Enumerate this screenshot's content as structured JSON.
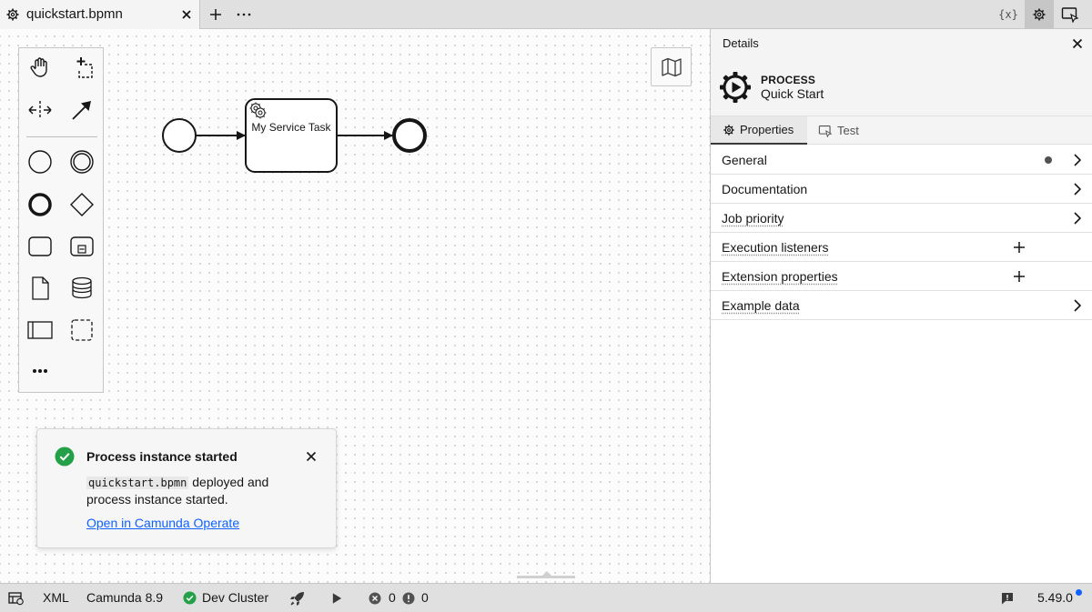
{
  "tab": {
    "title": "quickstart.bpmn"
  },
  "topbar": {
    "variables_label": "{x}"
  },
  "diagram": {
    "task_label": "My Service Task"
  },
  "notification": {
    "title": "Process instance started",
    "body_code": "quickstart.bpmn",
    "body_text": " deployed and process instance started.",
    "link": "Open in Camunda Operate"
  },
  "panel": {
    "title": "Details",
    "element_type": "PROCESS",
    "element_name": "Quick Start",
    "tabs": [
      "Properties",
      "Test"
    ],
    "groups": [
      {
        "label": "General",
        "action": "chevron",
        "has_dot": true,
        "dotted": false
      },
      {
        "label": "Documentation",
        "action": "chevron",
        "has_dot": false,
        "dotted": false
      },
      {
        "label": "Job priority",
        "action": "chevron",
        "has_dot": false,
        "dotted": true
      },
      {
        "label": "Execution listeners",
        "action": "plus",
        "has_dot": false,
        "dotted": true
      },
      {
        "label": "Extension properties",
        "action": "plus",
        "has_dot": false,
        "dotted": true
      },
      {
        "label": "Example data",
        "action": "chevron",
        "has_dot": false,
        "dotted": true
      }
    ]
  },
  "statusbar": {
    "xml_label": "XML",
    "engine": "Camunda 8.9",
    "cluster": "Dev Cluster",
    "errors": "0",
    "warnings": "0",
    "version": "5.49.0"
  },
  "colors": {
    "success": "#24a148",
    "link": "#0f62fe",
    "update_dot": "#0f62fe"
  },
  "icons": [
    "gear-icon",
    "close-icon",
    "plus-icon",
    "overflow-icon",
    "variables-icon",
    "settings-icon",
    "test-panel-icon",
    "hand-tool-icon",
    "lasso-tool-icon",
    "space-tool-icon",
    "connect-tool-icon",
    "start-event-icon",
    "intermediate-event-icon",
    "end-event-icon",
    "gateway-icon",
    "task-icon",
    "subprocess-icon",
    "data-object-icon",
    "data-store-icon",
    "pool-icon",
    "group-icon",
    "more-icon",
    "map-icon",
    "checkmark-icon",
    "chevron-right-icon",
    "deploy-icon",
    "run-icon",
    "error-icon",
    "warning-icon",
    "feedback-icon"
  ]
}
